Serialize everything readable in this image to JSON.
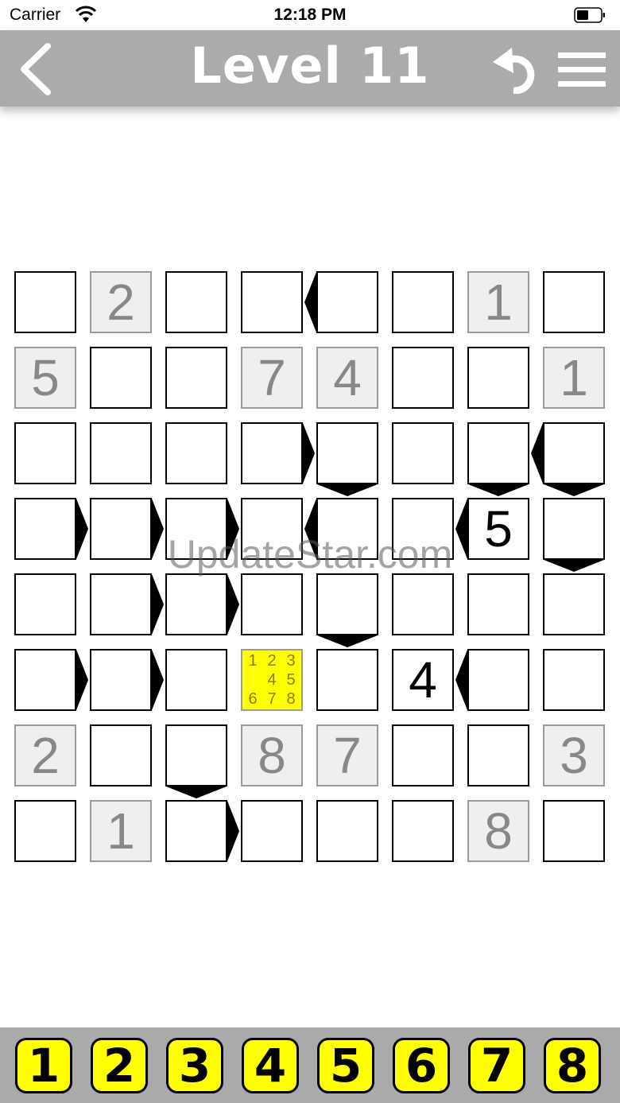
{
  "status_bar": {
    "carrier": "Carrier",
    "time": "12:18 PM"
  },
  "header": {
    "title": "Level 11"
  },
  "board": {
    "size": 8,
    "rows": [
      [
        {
          "v": "",
          "t": "empty"
        },
        {
          "v": "2",
          "t": "given"
        },
        {
          "v": "",
          "t": "empty"
        },
        {
          "v": "",
          "t": "empty"
        },
        {
          "v": "",
          "t": "empty"
        },
        {
          "v": "",
          "t": "empty"
        },
        {
          "v": "1",
          "t": "given"
        },
        {
          "v": "",
          "t": "empty"
        }
      ],
      [
        {
          "v": "5",
          "t": "given"
        },
        {
          "v": "",
          "t": "empty"
        },
        {
          "v": "",
          "t": "empty"
        },
        {
          "v": "7",
          "t": "given"
        },
        {
          "v": "4",
          "t": "given"
        },
        {
          "v": "",
          "t": "empty"
        },
        {
          "v": "",
          "t": "empty"
        },
        {
          "v": "1",
          "t": "given"
        }
      ],
      [
        {
          "v": "",
          "t": "empty"
        },
        {
          "v": "",
          "t": "empty"
        },
        {
          "v": "",
          "t": "empty"
        },
        {
          "v": "",
          "t": "empty"
        },
        {
          "v": "",
          "t": "empty"
        },
        {
          "v": "",
          "t": "empty"
        },
        {
          "v": "",
          "t": "empty"
        },
        {
          "v": "",
          "t": "empty"
        }
      ],
      [
        {
          "v": "",
          "t": "empty"
        },
        {
          "v": "",
          "t": "empty"
        },
        {
          "v": "",
          "t": "empty"
        },
        {
          "v": "",
          "t": "empty"
        },
        {
          "v": "",
          "t": "empty"
        },
        {
          "v": "",
          "t": "empty"
        },
        {
          "v": "5",
          "t": "entered"
        },
        {
          "v": "",
          "t": "empty"
        }
      ],
      [
        {
          "v": "",
          "t": "empty"
        },
        {
          "v": "",
          "t": "empty"
        },
        {
          "v": "",
          "t": "empty"
        },
        {
          "v": "",
          "t": "empty"
        },
        {
          "v": "",
          "t": "empty"
        },
        {
          "v": "",
          "t": "empty"
        },
        {
          "v": "",
          "t": "empty"
        },
        {
          "v": "",
          "t": "empty"
        }
      ],
      [
        {
          "v": "",
          "t": "empty"
        },
        {
          "v": "",
          "t": "empty"
        },
        {
          "v": "",
          "t": "empty"
        },
        {
          "v": "",
          "t": "selected",
          "notes": [
            "1",
            "2",
            "3",
            "",
            "4",
            "5",
            "6",
            "7",
            "8"
          ]
        },
        {
          "v": "",
          "t": "empty"
        },
        {
          "v": "4",
          "t": "entered"
        },
        {
          "v": "",
          "t": "empty"
        },
        {
          "v": "",
          "t": "empty"
        }
      ],
      [
        {
          "v": "2",
          "t": "given"
        },
        {
          "v": "",
          "t": "empty"
        },
        {
          "v": "",
          "t": "empty"
        },
        {
          "v": "8",
          "t": "given"
        },
        {
          "v": "7",
          "t": "given"
        },
        {
          "v": "",
          "t": "empty"
        },
        {
          "v": "",
          "t": "empty"
        },
        {
          "v": "3",
          "t": "given"
        }
      ],
      [
        {
          "v": "",
          "t": "empty"
        },
        {
          "v": "1",
          "t": "given"
        },
        {
          "v": "",
          "t": "empty"
        },
        {
          "v": "",
          "t": "empty"
        },
        {
          "v": "",
          "t": "empty"
        },
        {
          "v": "",
          "t": "empty"
        },
        {
          "v": "8",
          "t": "given"
        },
        {
          "v": "",
          "t": "empty"
        }
      ]
    ],
    "h_inequalities": [
      {
        "row": 0,
        "col": 3,
        "dir": "left"
      },
      {
        "row": 2,
        "col": 3,
        "dir": "right"
      },
      {
        "row": 2,
        "col": 6,
        "dir": "left"
      },
      {
        "row": 3,
        "col": 0,
        "dir": "right"
      },
      {
        "row": 3,
        "col": 1,
        "dir": "right"
      },
      {
        "row": 3,
        "col": 2,
        "dir": "right"
      },
      {
        "row": 3,
        "col": 3,
        "dir": "left"
      },
      {
        "row": 3,
        "col": 5,
        "dir": "left"
      },
      {
        "row": 4,
        "col": 1,
        "dir": "right"
      },
      {
        "row": 4,
        "col": 2,
        "dir": "right"
      },
      {
        "row": 5,
        "col": 0,
        "dir": "right"
      },
      {
        "row": 5,
        "col": 1,
        "dir": "right"
      },
      {
        "row": 5,
        "col": 5,
        "dir": "left"
      },
      {
        "row": 7,
        "col": 2,
        "dir": "right"
      }
    ],
    "v_inequalities": [
      {
        "row": 2,
        "col": 4,
        "dir": "down"
      },
      {
        "row": 2,
        "col": 6,
        "dir": "down"
      },
      {
        "row": 2,
        "col": 7,
        "dir": "down"
      },
      {
        "row": 3,
        "col": 7,
        "dir": "down"
      },
      {
        "row": 4,
        "col": 4,
        "dir": "down"
      },
      {
        "row": 6,
        "col": 2,
        "dir": "down"
      }
    ]
  },
  "watermark": "UpdateStar.com",
  "number_pad": [
    "1",
    "2",
    "3",
    "4",
    "5",
    "6",
    "7",
    "8"
  ],
  "colors": {
    "header": "#ababab",
    "selected": "#ffff00",
    "given_bg": "#efefef",
    "key": "#ffff00"
  }
}
